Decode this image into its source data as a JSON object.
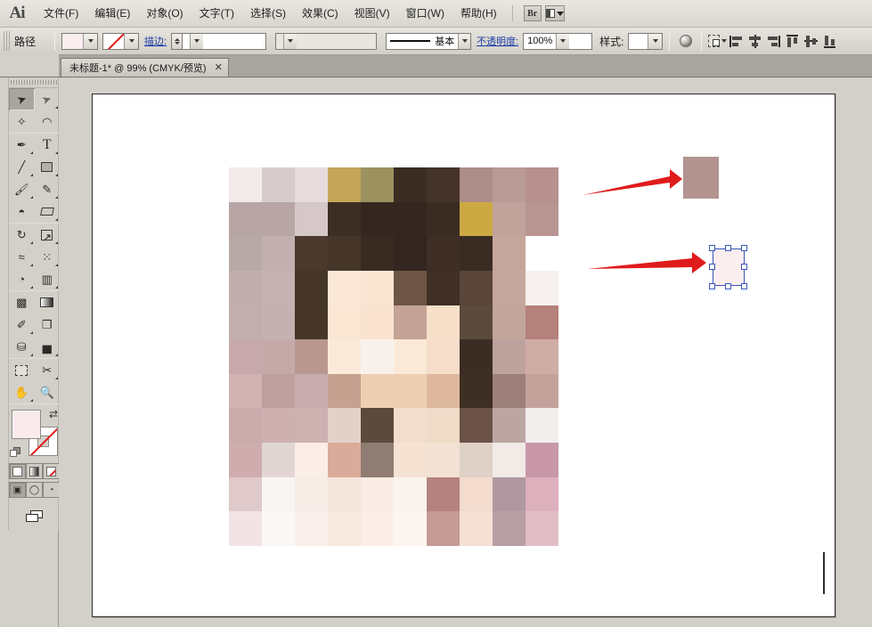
{
  "app": {
    "logo": "Ai",
    "menu": [
      {
        "label": "文件(F)",
        "name": "menu-file"
      },
      {
        "label": "编辑(E)",
        "name": "menu-edit"
      },
      {
        "label": "对象(O)",
        "name": "menu-object"
      },
      {
        "label": "文字(T)",
        "name": "menu-type"
      },
      {
        "label": "选择(S)",
        "name": "menu-select"
      },
      {
        "label": "效果(C)",
        "name": "menu-effect"
      },
      {
        "label": "视图(V)",
        "name": "menu-view"
      },
      {
        "label": "窗口(W)",
        "name": "menu-window"
      },
      {
        "label": "帮助(H)",
        "name": "menu-help"
      }
    ],
    "bridge_label": "Br",
    "arrange_label": ""
  },
  "control_bar": {
    "selection_label": "路径",
    "fill_swatch_color": "#fbeef0",
    "stroke_swatch_label": "none",
    "stroke_link_label": "描边:",
    "stroke_weight_value": "",
    "stroke_profile_value": "",
    "brush_label": "基本",
    "opacity_link_label": "不透明度:",
    "opacity_value": "100%",
    "style_label": "样式:",
    "style_swatch_color": "#ffffff"
  },
  "tabs": [
    {
      "title": "未标题-1* @ 99% (CMYK/预览)",
      "close": "✕",
      "active": true
    }
  ],
  "toolbar": {
    "tools": [
      {
        "name": "selection-tool",
        "glyph": "➤",
        "active": true,
        "corner": false
      },
      {
        "name": "direct-selection-tool",
        "glyph": "➤",
        "active": false,
        "corner": true
      },
      {
        "name": "magic-wand-tool",
        "glyph": "✧",
        "active": false,
        "corner": false
      },
      {
        "name": "lasso-tool",
        "glyph": "◠",
        "active": false,
        "corner": false
      },
      {
        "name": "pen-tool",
        "glyph": "✒",
        "active": false,
        "corner": true
      },
      {
        "name": "type-tool",
        "glyph": "T",
        "active": false,
        "corner": true
      },
      {
        "name": "line-segment-tool",
        "glyph": "／",
        "active": false,
        "corner": true
      },
      {
        "name": "rectangle-tool",
        "glyph": "▭",
        "active": false,
        "corner": true
      },
      {
        "name": "paintbrush-tool",
        "glyph": "🖌",
        "active": false,
        "corner": true
      },
      {
        "name": "pencil-tool",
        "glyph": "✎",
        "active": false,
        "corner": true
      },
      {
        "name": "blob-brush-tool",
        "glyph": "◓",
        "active": false,
        "corner": false
      },
      {
        "name": "eraser-tool",
        "glyph": "▱",
        "active": false,
        "corner": true
      },
      {
        "name": "rotate-tool",
        "glyph": "↻",
        "active": false,
        "corner": true
      },
      {
        "name": "scale-tool",
        "glyph": "⬀",
        "active": false,
        "corner": true
      },
      {
        "name": "width-tool",
        "glyph": "≈",
        "active": false,
        "corner": true
      },
      {
        "name": "free-transform-tool",
        "glyph": "⁘",
        "active": false,
        "corner": true
      },
      {
        "name": "shape-builder-tool",
        "glyph": "◔",
        "active": false,
        "corner": true
      },
      {
        "name": "perspective-grid-tool",
        "glyph": "▥",
        "active": false,
        "corner": true
      },
      {
        "name": "mesh-tool",
        "glyph": "▩",
        "active": false,
        "corner": false
      },
      {
        "name": "gradient-tool",
        "glyph": "▤",
        "active": false,
        "corner": false
      },
      {
        "name": "eyedropper-tool",
        "glyph": "✐",
        "active": false,
        "corner": true
      },
      {
        "name": "blend-tool",
        "glyph": "◳",
        "active": false,
        "corner": false
      },
      {
        "name": "symbol-sprayer-tool",
        "glyph": "⛁",
        "active": false,
        "corner": true
      },
      {
        "name": "column-graph-tool",
        "glyph": "▦",
        "active": false,
        "corner": true
      },
      {
        "name": "artboard-tool",
        "glyph": "▢",
        "active": false,
        "corner": false
      },
      {
        "name": "slice-tool",
        "glyph": "✂",
        "active": false,
        "corner": true
      },
      {
        "name": "hand-tool",
        "glyph": "✋",
        "active": false,
        "corner": true
      },
      {
        "name": "zoom-tool",
        "glyph": "🔍",
        "active": false,
        "corner": false
      }
    ],
    "fill_color": "#fbeaec",
    "stroke_color": "none",
    "swap_glyph": "⇄",
    "modes": [
      {
        "name": "color-mode-button",
        "kind": "solid",
        "selected": true
      },
      {
        "name": "gradient-mode-button",
        "kind": "grad",
        "selected": false
      },
      {
        "name": "none-mode-button",
        "kind": "none",
        "selected": false
      }
    ],
    "screen_modes": [
      {
        "name": "normal-screen-mode-button",
        "glyph": "▣",
        "selected": true
      },
      {
        "name": "fullscreen-menubar-mode-button",
        "glyph": "◻",
        "selected": false
      },
      {
        "name": "fullscreen-mode-button",
        "glyph": "◻",
        "selected": false
      }
    ]
  },
  "canvas": {
    "mosaic": {
      "rows": 11,
      "cols": 10,
      "colors": [
        [
          "#f3eaec",
          "#d7cccb",
          "#e7dbdd",
          "#c4a659",
          "#9c9260",
          "#3b2d22",
          "#44332a",
          "#ad8d8a",
          "#ba9a95",
          "#b6918d"
        ],
        [
          "#b8a6a6",
          "#b8a6a6",
          "#d6c8c9",
          "#3d2e23",
          "#352720",
          "#342720",
          "#3b2c23",
          "#cda944",
          "#c2a39c",
          "#b89592"
        ],
        [
          "#b8a8a8",
          "#c2b0b1",
          "#4a392c",
          "#46362a",
          "#3a2b22",
          "#332620",
          "#3e2e25",
          "#3a2c23",
          "#c5a69d",
          "#ffffff"
        ],
        [
          "#c0aeae",
          "#c5b3b3",
          "#46362a",
          "#fbe7d6",
          "#fae5d2",
          "#6d5645",
          "#3f2f25",
          "#59453a",
          "#c6a79e",
          "#f6f0ee"
        ],
        [
          "#c3aeaf",
          "#c5b1b2",
          "#46362a",
          "#fbe6d4",
          "#f9e3d0",
          "#c3a395",
          "#f7e0ca",
          "#5c4a3c",
          "#c3a59c",
          "#b4817c"
        ],
        [
          "#c8a9ab",
          "#c5a9a9",
          "#b9978f",
          "#fbe9da",
          "#f9f2ec",
          "#fbe9d8",
          "#f6decb",
          "#3c2d24",
          "#bda29d",
          "#cfaca6"
        ],
        [
          "#d1b3b4",
          "#c0a09f",
          "#c7adad",
          "#c6a190",
          "#eecfb2",
          "#eecfb2",
          "#ddb89e",
          "#3e2f25",
          "#9d807c",
          "#c4a29c"
        ],
        [
          "#ccabad",
          "#ceb0b1",
          "#cdb2b2",
          "#e3d1c9",
          "#5c4a3c",
          "#f2dccb",
          "#f0dac8",
          "#6a5346",
          "#bba6a2",
          "#f2eeec"
        ],
        [
          "#cfacad",
          "#e2d6d4",
          "#faeee6",
          "#d9ab9a",
          "#8f7c72",
          "#f6e2d3",
          "#f3e2d3",
          "#ded1c6",
          "#f1eae7",
          "#c898a8"
        ],
        [
          "#dfc9cb",
          "#f9f5f4",
          "#f7ece6",
          "#f5e6dc",
          "#f8ece4",
          "#fbf3ed",
          "#b5827f",
          "#f3dbce",
          "#b098a0",
          "#ddb0bd"
        ],
        [
          "#f2e4e6",
          "#fbf7f6",
          "#f9f0eb",
          "#f7e9e0",
          "#faeee7",
          "#fcf5f0",
          "#c69a97",
          "#f5e0d5",
          "#b79fa6",
          "#e2bcc6"
        ]
      ]
    },
    "arrow_color": "#e01b1b",
    "sample_swatch_color": "#b2938f",
    "selected_swatch_color": "#fbeef0",
    "selection_border_color": "#3a55b4",
    "selection_handle_color": "#ffffff"
  }
}
